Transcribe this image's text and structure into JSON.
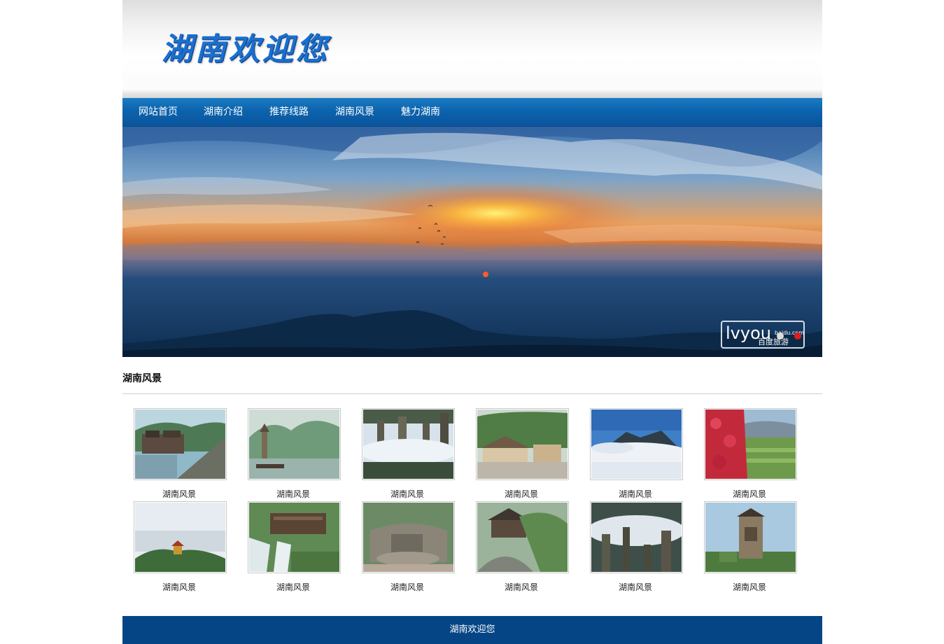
{
  "header": {
    "logo_text": "湖南欢迎您"
  },
  "nav": {
    "items": [
      {
        "label": "网站首页"
      },
      {
        "label": "湖南介绍"
      },
      {
        "label": "推荐线路"
      },
      {
        "label": "湖南风景"
      },
      {
        "label": "魅力湖南"
      }
    ]
  },
  "banner": {
    "watermark_text": "lvyou",
    "watermark_sub": "百度旅游",
    "watermark_domain": "baidu.com",
    "slide_count": 2,
    "active_slide": 2
  },
  "section": {
    "title": "湖南风景"
  },
  "gallery": {
    "items": [
      {
        "caption": "湖南风景"
      },
      {
        "caption": "湖南风景"
      },
      {
        "caption": "湖南风景"
      },
      {
        "caption": "湖南风景"
      },
      {
        "caption": "湖南风景"
      },
      {
        "caption": "湖南风景"
      },
      {
        "caption": "湖南风景"
      },
      {
        "caption": "湖南风景"
      },
      {
        "caption": "湖南风景"
      },
      {
        "caption": "湖南风景"
      },
      {
        "caption": "湖南风景"
      },
      {
        "caption": "湖南风景"
      }
    ]
  },
  "footer": {
    "text": "湖南欢迎您"
  }
}
